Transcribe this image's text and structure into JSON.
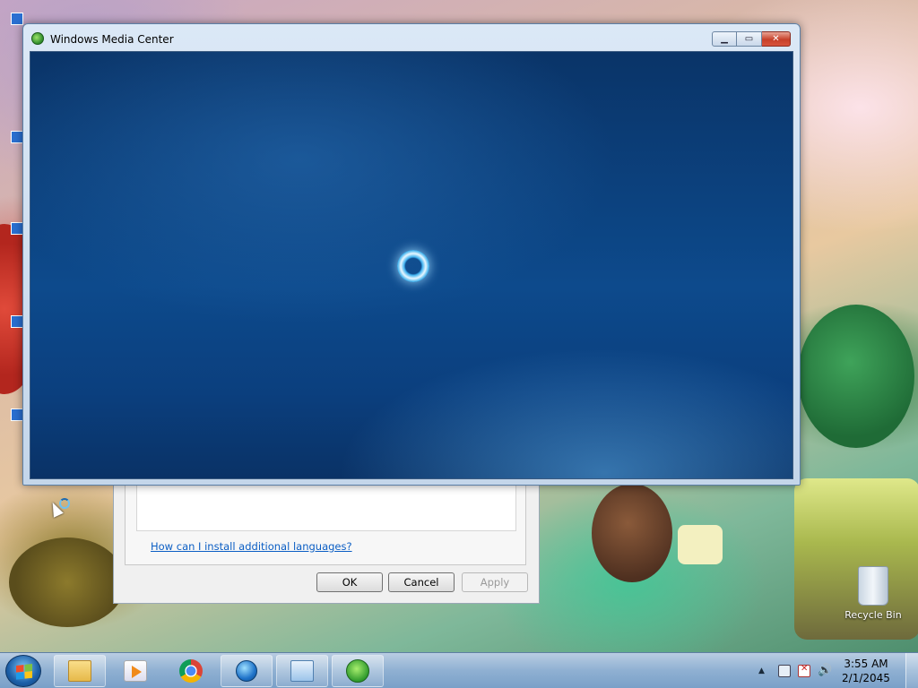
{
  "window": {
    "title": "Windows Media Center"
  },
  "dialog": {
    "help_link": "How can I install additional languages?",
    "ok_label": "OK",
    "cancel_label": "Cancel",
    "apply_label": "Apply"
  },
  "desktop": {
    "recycle_bin_label": "Recycle Bin"
  },
  "taskbar": {
    "clock_time": "3:55 AM",
    "clock_date": "2/1/2045",
    "pinned": [
      "windows-explorer-icon",
      "media-player-icon",
      "chrome-icon",
      "globe-clock-icon",
      "control-panel-icon",
      "media-center-icon"
    ]
  },
  "colors": {
    "wmc_background": "#0d4a8c",
    "link": "#0b5ec4",
    "close_button": "#c7402a"
  }
}
